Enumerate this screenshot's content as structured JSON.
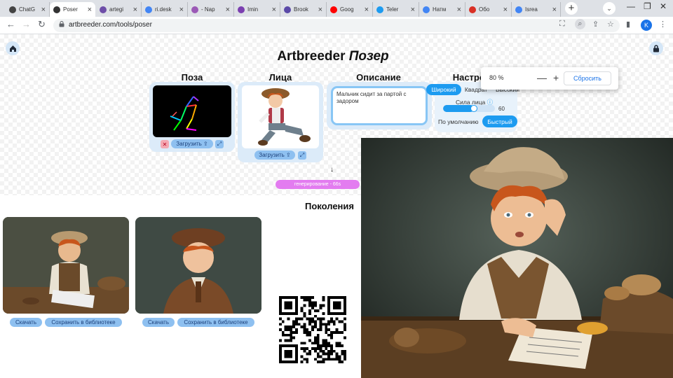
{
  "browser": {
    "tabs": [
      {
        "title": "ChatG",
        "color": "#444444",
        "active": false
      },
      {
        "title": "Poser",
        "color": "#333333",
        "active": true
      },
      {
        "title": "artegi",
        "color": "#6e4ea8",
        "active": false
      },
      {
        "title": "ri.desk",
        "color": "#4285f4",
        "active": false
      },
      {
        "title": "- Nap",
        "color": "#9b59b6",
        "active": false
      },
      {
        "title": "Imin",
        "color": "#7b3fb0",
        "active": false
      },
      {
        "title": "Brook",
        "color": "#5b4aa8",
        "active": false
      },
      {
        "title": "Goog",
        "color": "#ff0000",
        "active": false
      },
      {
        "title": "Teler",
        "color": "#1d9bf0",
        "active": false
      },
      {
        "title": "Натм",
        "color": "#4285f4",
        "active": false
      },
      {
        "title": "Обо",
        "color": "#d93025",
        "active": false
      },
      {
        "title": "Isrea",
        "color": "#4285f4",
        "active": false
      }
    ],
    "url": "artbreeder.com/tools/poser",
    "avatar_letter": "K",
    "zoom": {
      "value": "80 %",
      "minus": "—",
      "plus": "+",
      "reset": "Сбросить"
    }
  },
  "app": {
    "brand": "Artbreeder",
    "tool": "Позер",
    "sections": {
      "pose": "Поза",
      "faces": "Лица",
      "description": "Описание",
      "settings": "Настройки"
    },
    "upload_label": "Загрузить",
    "description_text": "Мальчик сидит за партой с задором",
    "settings": {
      "formats": [
        "Широкий",
        "Квадрат",
        "Высокий"
      ],
      "selected_format": "Широкий",
      "strength_label": "Сила лица",
      "strength_value": "60",
      "strength_fraction": 0.6,
      "default_label": "По умолчанию",
      "fast_label": "Быстрый"
    },
    "status": "генерирование - 66s",
    "generations_title": "Поколения",
    "generation_actions": {
      "download": "Скачать",
      "save": "Сохранить в библиотеке"
    }
  }
}
